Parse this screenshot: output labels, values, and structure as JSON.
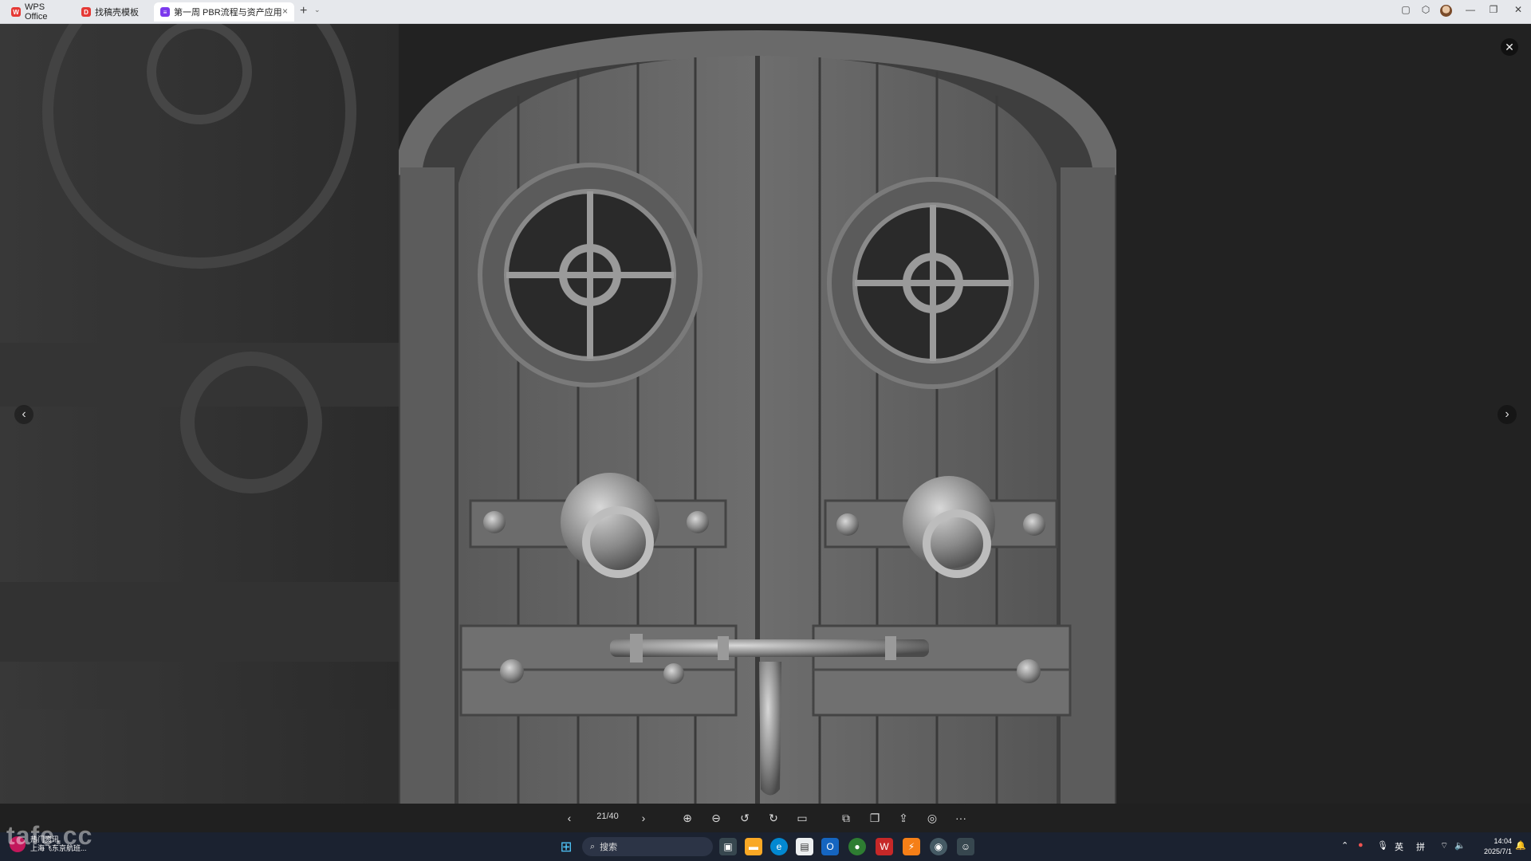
{
  "tabs": [
    {
      "label": "WPS Office",
      "icon": "wps-logo-icon"
    },
    {
      "label": "找稿壳模板",
      "icon": "template-icon"
    },
    {
      "label": "第一周 PBR流程与资产应用",
      "icon": "document-icon",
      "close": "×"
    }
  ],
  "tabbar": {
    "new_tab": "+",
    "new_tab_menu": "⌄"
  },
  "window_controls": {
    "minimize": "—",
    "restore": "❐",
    "close": "✕"
  },
  "viewer": {
    "close": "✕",
    "prev": "‹",
    "next": "›",
    "page": "21/40"
  },
  "toolbar": {
    "prev": "‹",
    "next": "›",
    "zoom_in": "⊕",
    "zoom_out": "⊖",
    "rotate_left": "↺",
    "rotate_right": "↻",
    "fit": "▭",
    "crop": "⧉",
    "copy": "❐",
    "share": "⇪",
    "pin": "◎",
    "more": "···"
  },
  "taskbar": {
    "news_title": "热门资讯",
    "news_sub": "上海飞东京航班...",
    "search": "搜索",
    "tray_lang": "英",
    "tray_ime": "拼",
    "time": "14:04",
    "date": "2025/7/1"
  },
  "watermark": "tafe.cc",
  "colors": {
    "accent": "#7c3aed",
    "wps_red": "#e53935",
    "taskbar": "#1b2230"
  }
}
